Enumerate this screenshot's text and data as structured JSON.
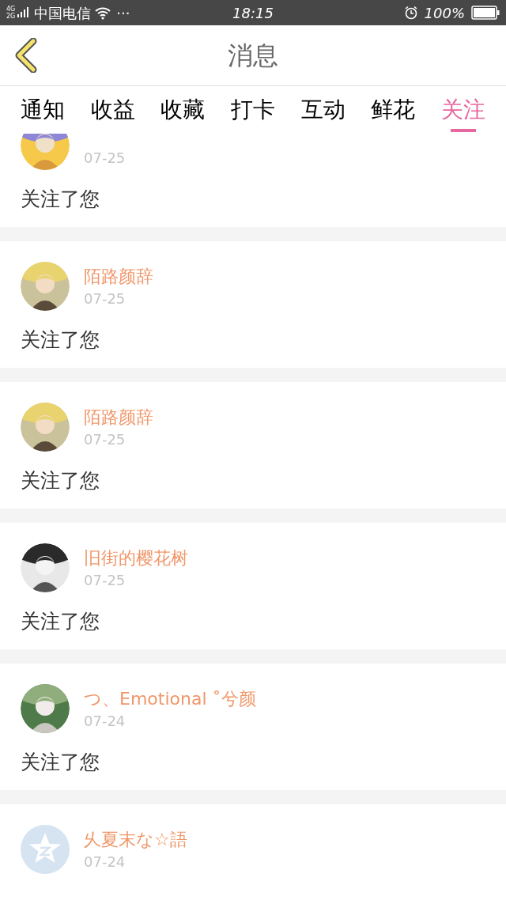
{
  "status_bar": {
    "network_top": "4G",
    "network_bottom": "2G",
    "carrier": "中国电信",
    "more": "···",
    "time": "18:15",
    "battery": "100%"
  },
  "header": {
    "title": "消息"
  },
  "tabs": [
    {
      "label": "通知",
      "selected": false
    },
    {
      "label": "收益",
      "selected": false
    },
    {
      "label": "收藏",
      "selected": false
    },
    {
      "label": "打卡",
      "selected": false
    },
    {
      "label": "互动",
      "selected": false
    },
    {
      "label": "鲜花",
      "selected": false
    },
    {
      "label": "关注",
      "selected": true
    }
  ],
  "messages": [
    {
      "kind": "picture",
      "date": "07-25",
      "text": "关注了您"
    },
    {
      "kind": "picture",
      "name": "陌路颜辞",
      "date": "07-25",
      "text": "关注了您"
    },
    {
      "kind": "picture",
      "name": "陌路颜辞",
      "date": "07-25",
      "text": "关注了您"
    },
    {
      "kind": "picture",
      "name": "旧街的樱花树",
      "date": "07-25",
      "text": "关注了您"
    },
    {
      "kind": "picture",
      "name": "つ、Emotional ˚兮颜",
      "date": "07-24",
      "text": "关注了您"
    },
    {
      "kind": "default",
      "name": "乆夏末な☆語",
      "date": "07-24"
    }
  ]
}
